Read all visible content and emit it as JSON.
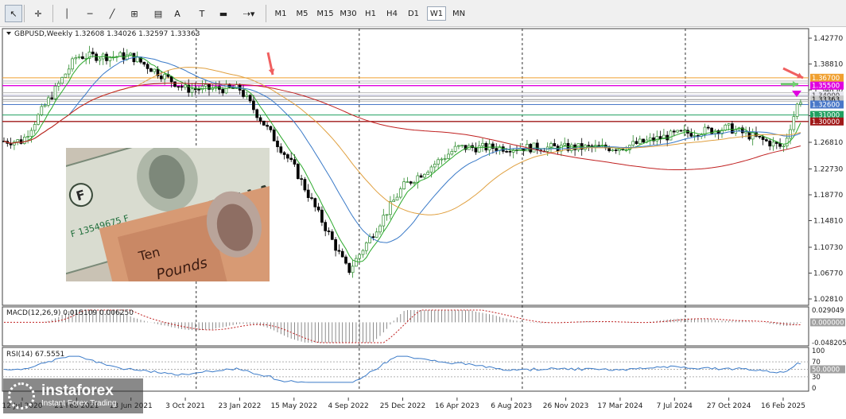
{
  "toolbar": {
    "tools": [
      {
        "name": "cursor-icon",
        "glyph": "↖"
      },
      {
        "name": "crosshair-icon",
        "glyph": "✛"
      },
      {
        "name": "vertical-line-icon",
        "glyph": "│"
      },
      {
        "name": "horizontal-line-icon",
        "glyph": "─"
      },
      {
        "name": "trendline-icon",
        "glyph": "╱"
      },
      {
        "name": "fibonacci-icon",
        "glyph": "⊞"
      },
      {
        "name": "channel-icon",
        "glyph": "▤"
      },
      {
        "name": "text-icon",
        "glyph": "A"
      },
      {
        "name": "label-icon",
        "glyph": "T"
      },
      {
        "name": "rectangle-icon",
        "glyph": "▬"
      },
      {
        "name": "shapes-dropdown-icon",
        "glyph": "⇢▾"
      }
    ],
    "timeframes": [
      "M1",
      "M5",
      "M15",
      "M30",
      "H1",
      "H4",
      "D1",
      "W1",
      "MN"
    ],
    "active_timeframe": "W1"
  },
  "chart": {
    "header": "GBPUSD,Weekly  1.32608 1.34026 1.32597 1.33363",
    "price_axis": [
      "1.42770",
      "1.38810",
      "1.34850",
      "1.30890",
      "1.26810",
      "1.22730",
      "1.18770",
      "1.14810",
      "1.10730",
      "1.06770",
      "1.02810"
    ],
    "level_tags": [
      {
        "text": "1.36700",
        "color": "#f0a030",
        "text_color": "#ffffff"
      },
      {
        "text": "1.35500",
        "color": "#e000e0",
        "text_color": "#ffffff"
      },
      {
        "text": "1.34000",
        "color": "#e8e8f0",
        "text_color": "#444444"
      },
      {
        "text": "1.33363",
        "color": "#c8c8c8",
        "text_color": "#000000"
      },
      {
        "text": "1.32600",
        "color": "#4a78c8",
        "text_color": "#ffffff"
      },
      {
        "text": "1.31000",
        "color": "#20a060",
        "text_color": "#ffffff"
      },
      {
        "text": "1.30000",
        "color": "#a01818",
        "text_color": "#ffffff"
      }
    ],
    "date_axis": [
      "12 Jul 2020",
      "21 Feb 2021",
      "13 Jun 2021",
      "3 Oct 2021",
      "23 Jan 2022",
      "15 May 2022",
      "4 Sep 2022",
      "25 Dec 2022",
      "16 Apr 2023",
      "6 Aug 2023",
      "26 Nov 2023",
      "17 Mar 2024",
      "7 Jul 2024",
      "27 Oct 2024",
      "16 Feb 2025"
    ]
  },
  "macd": {
    "label": "MACD(12,26,9) 0.015109 0.006250",
    "axis": [
      "0.029049",
      "0.000000",
      "-0.048205"
    ]
  },
  "rsi": {
    "label": "RSI(14) 67.5551",
    "axis": [
      "100",
      "70",
      "50.0000",
      "30",
      "0"
    ]
  },
  "watermark": {
    "brand": "instaforex",
    "tagline": "Instant Forex Trading"
  },
  "chart_data": {
    "type": "candlestick",
    "title": "GBPUSD,Weekly",
    "last_bar": {
      "open": 1.32608,
      "high": 1.34026,
      "low": 1.32597,
      "close": 1.33363
    },
    "ylim": [
      1.0281,
      1.4277
    ],
    "price_path": [
      [
        "12 Jul 2020",
        1.27
      ],
      [
        "21 Feb 2021",
        1.4
      ],
      [
        "13 Jun 2021",
        1.4
      ],
      [
        "3 Oct 2021",
        1.35
      ],
      [
        "23 Jan 2022",
        1.35
      ],
      [
        "15 May 2022",
        1.23
      ],
      [
        "4 Sep 2022",
        1.07
      ],
      [
        "25 Dec 2022",
        1.2
      ],
      [
        "16 Apr 2023",
        1.26
      ],
      [
        "6 Aug 2023",
        1.26
      ],
      [
        "26 Nov 2023",
        1.26
      ],
      [
        "17 Mar 2024",
        1.26
      ],
      [
        "7 Jul 2024",
        1.28
      ],
      [
        "27 Oct 2024",
        1.29
      ],
      [
        "16 Feb 2025",
        1.26
      ],
      [
        "latest",
        1.33363
      ]
    ],
    "horizontal_levels": [
      1.367,
      1.355,
      1.34,
      1.33363,
      1.326,
      1.31,
      1.3
    ],
    "macd": {
      "macd": 0.015109,
      "signal": 0.00625,
      "range": [
        -0.048205,
        0.029049
      ]
    },
    "rsi": {
      "value": 67.5551,
      "levels": [
        70,
        50,
        30
      ]
    },
    "colors": {
      "bull": "#2a8a2a",
      "bear": "#000000",
      "ma_fast": "#2aa82a",
      "ma_mid": "#3a7ac8",
      "ma_slow": "#e0a040",
      "ma_long": "#c02020",
      "arrow": "#f06060"
    }
  }
}
